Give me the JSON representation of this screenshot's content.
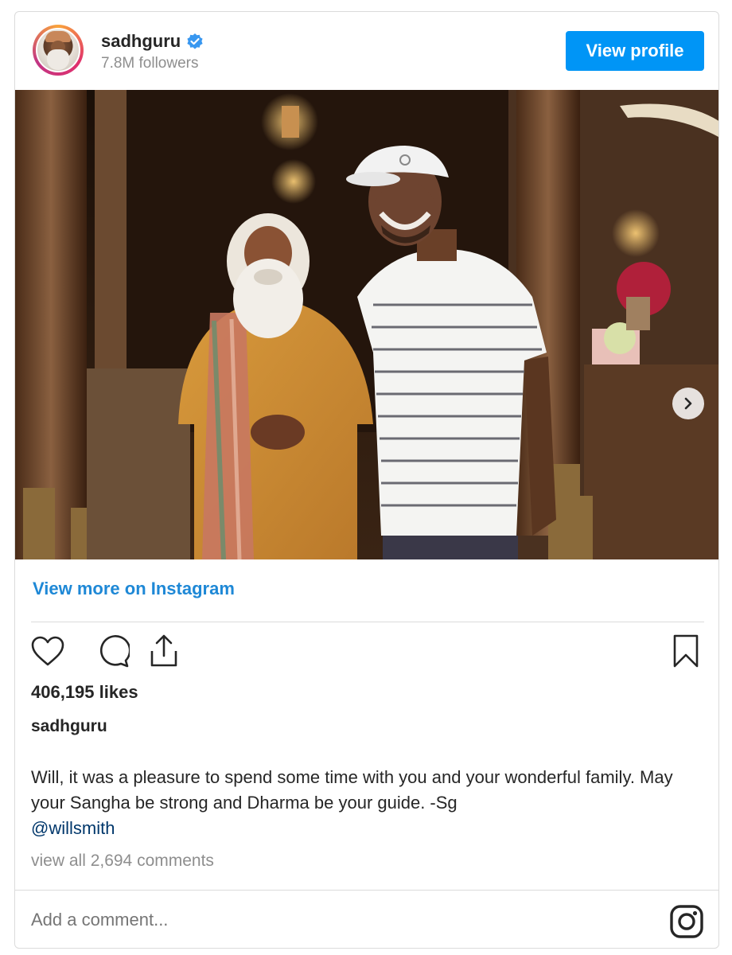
{
  "header": {
    "username": "sadhguru",
    "followers": "7.8M followers",
    "view_profile_label": "View profile"
  },
  "icons": {
    "verified": "verified-badge-icon",
    "next": "chevron-right-icon",
    "like": "heart-icon",
    "comment": "comment-bubble-icon",
    "share": "share-icon",
    "save": "bookmark-icon",
    "instagram": "instagram-logo-icon"
  },
  "carousel": {
    "active_index": 0,
    "total": 4
  },
  "links": {
    "view_more": "View more on Instagram"
  },
  "post": {
    "likes": "406,195 likes",
    "caption_user": "sadhguru",
    "caption_text": "Will, it was a pleasure to spend some time with you and your wonderful family. May your Sangha be strong and Dharma be your guide. -Sg",
    "mention": "@willsmith",
    "comments_link": "view all 2,694 comments"
  },
  "comment_box": {
    "placeholder": "Add a comment..."
  },
  "colors": {
    "accent": "#0095f6",
    "link": "#1e88d6",
    "mention": "#00376b",
    "muted": "#8e8e8e",
    "text": "#262626",
    "border": "#dbdbdb"
  }
}
